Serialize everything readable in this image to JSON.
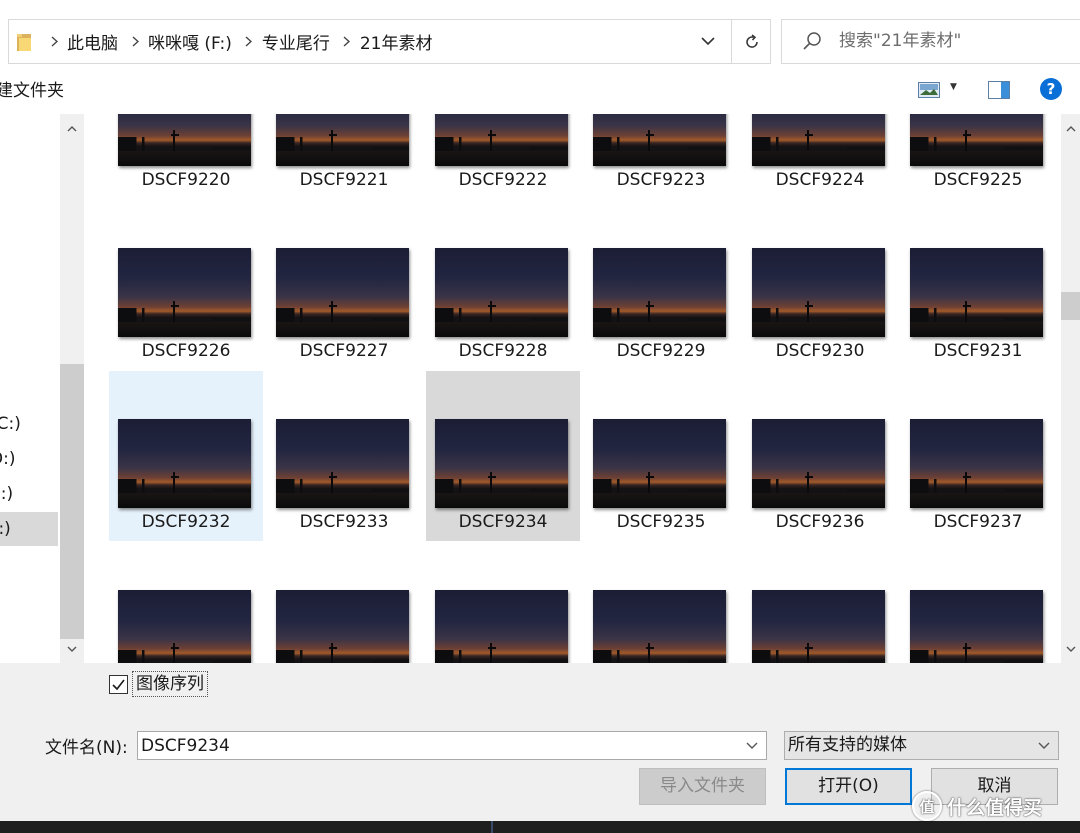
{
  "address": {
    "breadcrumb": [
      "此电脑",
      "咪咪嘎 (F:)",
      "专业尾行",
      "21年素材"
    ]
  },
  "search": {
    "placeholder": "搜索\"21年素材\""
  },
  "toolbar": {
    "new_folder_label": "建文件夹"
  },
  "nav": {
    "items": [
      {
        "label": "(C:)",
        "selected": false
      },
      {
        "label": "D:)",
        "selected": false
      },
      {
        "label": "E:)",
        "selected": false
      },
      {
        "label": "F:)",
        "selected": true
      }
    ]
  },
  "files": [
    {
      "name": "DSCF9220",
      "state": "normal"
    },
    {
      "name": "DSCF9221",
      "state": "normal"
    },
    {
      "name": "DSCF9222",
      "state": "normal"
    },
    {
      "name": "DSCF9223",
      "state": "normal"
    },
    {
      "name": "DSCF9224",
      "state": "normal"
    },
    {
      "name": "DSCF9225",
      "state": "normal"
    },
    {
      "name": "DSCF9226",
      "state": "normal"
    },
    {
      "name": "DSCF9227",
      "state": "normal"
    },
    {
      "name": "DSCF9228",
      "state": "normal"
    },
    {
      "name": "DSCF9229",
      "state": "normal"
    },
    {
      "name": "DSCF9230",
      "state": "normal"
    },
    {
      "name": "DSCF9231",
      "state": "normal"
    },
    {
      "name": "DSCF9232",
      "state": "hover"
    },
    {
      "name": "DSCF9233",
      "state": "normal"
    },
    {
      "name": "DSCF9234",
      "state": "selected"
    },
    {
      "name": "DSCF9235",
      "state": "normal"
    },
    {
      "name": "DSCF9236",
      "state": "normal"
    },
    {
      "name": "DSCF9237",
      "state": "normal"
    },
    {
      "name": "",
      "state": "normal"
    },
    {
      "name": "",
      "state": "normal"
    },
    {
      "name": "",
      "state": "normal"
    },
    {
      "name": "",
      "state": "normal"
    },
    {
      "name": "",
      "state": "normal"
    },
    {
      "name": "",
      "state": "normal"
    }
  ],
  "options": {
    "image_sequence_label": "图像序列",
    "image_sequence_checked": true
  },
  "filename": {
    "label": "文件名(N):",
    "value": "DSCF9234"
  },
  "filetype": {
    "selected": "所有支持的媒体"
  },
  "buttons": {
    "import_folder": "导入文件夹",
    "open": "打开(O)",
    "cancel": "取消"
  },
  "watermark": {
    "badge": "值",
    "text": "什么值得买"
  },
  "colors": {
    "accent": "#0078d7",
    "help": "#0a6fd6",
    "selection_light": "#e5f1fb",
    "selection_gray": "#d9d9d9"
  }
}
